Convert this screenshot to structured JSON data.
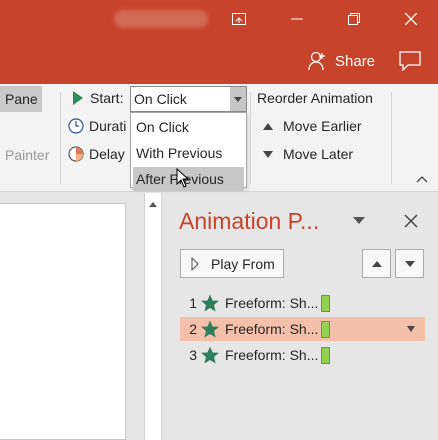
{
  "titlebar": {
    "share_label": "Share"
  },
  "ribbon": {
    "pane_label": "Pane",
    "painter_label": "Painter",
    "start_label": "Start:",
    "duration_label": "Durati",
    "delay_label": "Delay",
    "start_value": "On Click",
    "start_options": [
      "On Click",
      "With Previous",
      "After Previous"
    ],
    "highlighted_option": "After Previous",
    "reorder_title": "Reorder Animation",
    "move_earlier": "Move Earlier",
    "move_later": "Move Later"
  },
  "animation_pane": {
    "title": "Animation P...",
    "play_from": "Play From",
    "items": [
      {
        "num": "1",
        "label": "Freeform: Sh...",
        "selected": false
      },
      {
        "num": "2",
        "label": "Freeform: Sh...",
        "selected": true
      },
      {
        "num": "3",
        "label": "Freeform: Sh...",
        "selected": false
      }
    ]
  },
  "colors": {
    "titlebar": "#c8432b",
    "accent_text": "#c8432b",
    "star": "#2e7d5b",
    "timing_bar": "#92d050",
    "selected_row": "#f5c0a9"
  }
}
